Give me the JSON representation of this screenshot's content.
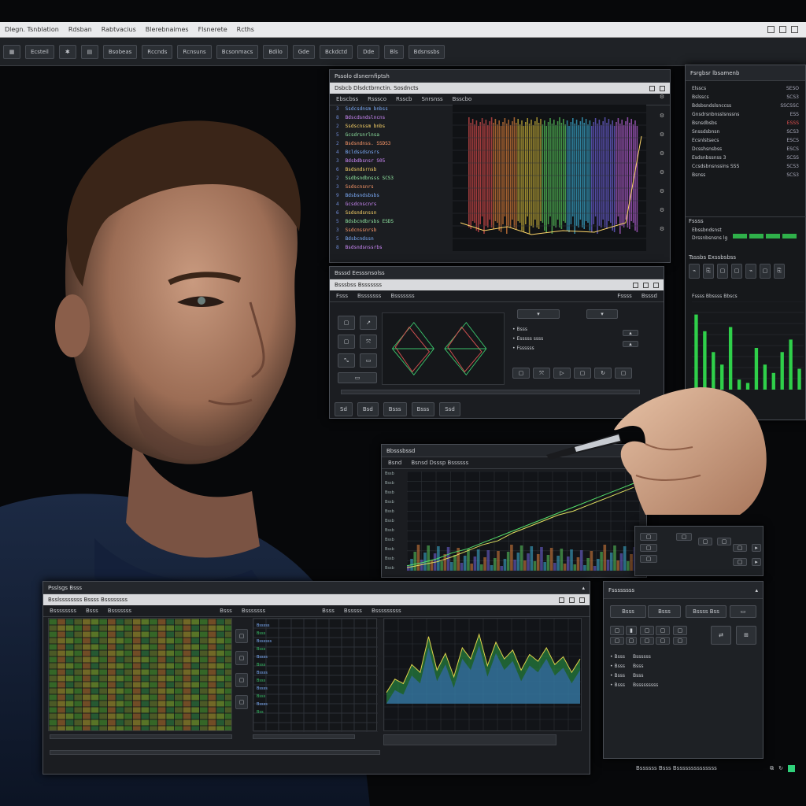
{
  "titlebar": {
    "menus": [
      "Dlegn. Tsnblation",
      "Rdsban",
      "Rabtvacius",
      "Blerebnaimes",
      "Flsnerete",
      "Rcths"
    ]
  },
  "toolbar": {
    "buttons": [
      "Ecsteil",
      "Bsobeas",
      "Rccnds",
      "Rcnsuns",
      "Bcsonmacs",
      "Bdilo",
      "Gde",
      "Bckdctd",
      "Dde",
      "Bls",
      "Bdsnssbs"
    ]
  },
  "code_window": {
    "title": "Pssolo dlsnernfiptsh",
    "subtitle": "Dsbcb Dlsdctbrnctin. Sosdncts",
    "tabs": [
      "Ebscbss",
      "Rsssco",
      "Rsscb",
      "Snrsnss",
      "Bsscbo"
    ],
    "lines": [
      {
        "n": "3",
        "t": "Ssdcsdnsm bnbss"
      },
      {
        "n": "8",
        "t": "Bdscdsndslncns"
      },
      {
        "n": "2",
        "t": "Ssdscnssm bnbs"
      },
      {
        "n": "5",
        "t": "Gcsdrsnrlnsa"
      },
      {
        "n": "2",
        "t": "Bsdsndnss. SSDS3"
      },
      {
        "n": "4",
        "t": "Bcldssdsnsrs"
      },
      {
        "n": "3",
        "t": "Bdsbdbsnsr S05"
      },
      {
        "n": "6",
        "t": "Bsdsndsrnsb"
      },
      {
        "n": "2",
        "t": "Ssdbsndbnsss SCS3"
      },
      {
        "n": "3",
        "t": "Ssdscnsnrs"
      },
      {
        "n": "9",
        "t": "Bdsbsndsbsbs"
      },
      {
        "n": "4",
        "t": "Gcsdcnscnrs"
      },
      {
        "n": "6",
        "t": "Ssdsndsnssn"
      },
      {
        "n": "5",
        "t": "Bdsbcndbrsbs ESDS"
      },
      {
        "n": "3",
        "t": "Ssdcnssnrsb"
      },
      {
        "n": "5",
        "t": "Bdsbcndssn"
      },
      {
        "n": "8",
        "t": "Bsdsndsnssrbs"
      }
    ]
  },
  "side_panel": {
    "title": "Fsrgbsr lbsamenb",
    "rows": [
      {
        "label": "Elsscs",
        "value": "SESO"
      },
      {
        "label": "Bslsscs",
        "value": "SCS3"
      },
      {
        "label": "Bdsbsndslsnccss",
        "value": "SSCSSC"
      },
      {
        "label": "Gnsdrsnbnsslsnssns",
        "value": "ESS"
      },
      {
        "label": "Bsnsdbsbs",
        "value": "ESSS"
      },
      {
        "label": "Snssdsbnsn",
        "value": "SCS3"
      },
      {
        "label": "Ecsnlstsecs",
        "value": "ESCS"
      },
      {
        "label": "Dcsshsnsbss",
        "value": "ESCS"
      },
      {
        "label": "Esdsnbssnss 3",
        "value": "SCSS"
      },
      {
        "label": "Ccsdsbnsnssins SSS",
        "value": "SCS3"
      },
      {
        "label": "Bsnss",
        "value": "SCS3"
      }
    ],
    "section_label": "Fssss",
    "sub_label": "Ebssbndsnst",
    "sub_label2": "Drssnbsnsns lg",
    "tabs_label": "Tsssbs   Exssbsbss",
    "bar_header": "Fssss  Bbssss  Bbscs",
    "bar_chart": {
      "type": "bar",
      "values": [
        0.9,
        0.7,
        0.45,
        0.3,
        0.75,
        0.12,
        0.08,
        0.5,
        0.3,
        0.2,
        0.45,
        0.6,
        0.25
      ],
      "ylim": [
        0,
        1
      ]
    }
  },
  "editor_window": {
    "title": "Bsssd Eesssnsolss",
    "subtitle": "Bsssbss Bsssssss",
    "tabs": [
      "Fsss",
      "Bsssssss",
      "Bsssssss"
    ],
    "right_tabs": [
      "Fssss",
      "Bsssd"
    ],
    "props": [
      "Bsss",
      "Esssss ssss",
      "Fssssss"
    ],
    "buttons": [
      "Sd",
      "Bsd",
      "Bsss",
      "Bsss",
      "Ssd"
    ]
  },
  "line_window": {
    "title": "Bbsssbssd",
    "tabs": [
      "Bsnd",
      "Bsnsd Dsssp Bssssss"
    ],
    "y_ticks": [
      "Bssb",
      "Bssb",
      "Bssb",
      "Bssb",
      "Bssb",
      "Bssb",
      "Bssb",
      "Bssb",
      "Bssb",
      "Bssb",
      "Bssb"
    ],
    "chart_data": {
      "type": "line",
      "series": [
        {
          "values": [
            5,
            8,
            12,
            18,
            22,
            28,
            34,
            40,
            46,
            52,
            58,
            64,
            70,
            76,
            82,
            88
          ]
        },
        {
          "values": [
            3,
            6,
            9,
            14,
            20,
            26,
            30,
            38,
            44,
            50,
            56,
            60,
            66,
            72,
            78,
            84
          ]
        }
      ],
      "ylim": [
        0,
        100
      ]
    }
  },
  "bottom_window": {
    "title": "Psslsgs Bsss",
    "subtitle": "Bsslssssssss Bssss Bssssssss",
    "tabs": [
      "Bssssssss",
      "Bsss",
      "Bsssssss"
    ],
    "right_tabs": [
      "Bsss",
      "Bsssssss"
    ],
    "area_tabs": [
      "Bsss",
      "Bsssss",
      "Bsssssssss"
    ],
    "mini_list": [
      "Bsssss",
      "Bsss",
      "Bssssss",
      "Bsss",
      "Bssss",
      "Bsss",
      "Bssss",
      "Bsss",
      "Bssss",
      "Bsss",
      "Bssss",
      "Bss"
    ],
    "area_chart": {
      "type": "area",
      "values": [
        10,
        22,
        18,
        35,
        28,
        60,
        30,
        45,
        24,
        50,
        40,
        62,
        34,
        55,
        40,
        48,
        30,
        44,
        38,
        50,
        35,
        42,
        28,
        40
      ]
    }
  },
  "control_panel": {
    "title": "Fssssssss",
    "buttons_row1": [
      "Bsss",
      "Bsss",
      "Bssss Bss"
    ],
    "list": [
      {
        "k": "Bsss",
        "v": "Bssssss"
      },
      {
        "k": "Bsss",
        "v": "Bsss"
      },
      {
        "k": "Bsss",
        "v": "Bsss"
      },
      {
        "k": "Bsss",
        "v": "Bsssssssss"
      }
    ]
  },
  "statusbar": {
    "text": "Bssssss Bsss Bssssssssssssss",
    "accent": "#2fd07a"
  }
}
